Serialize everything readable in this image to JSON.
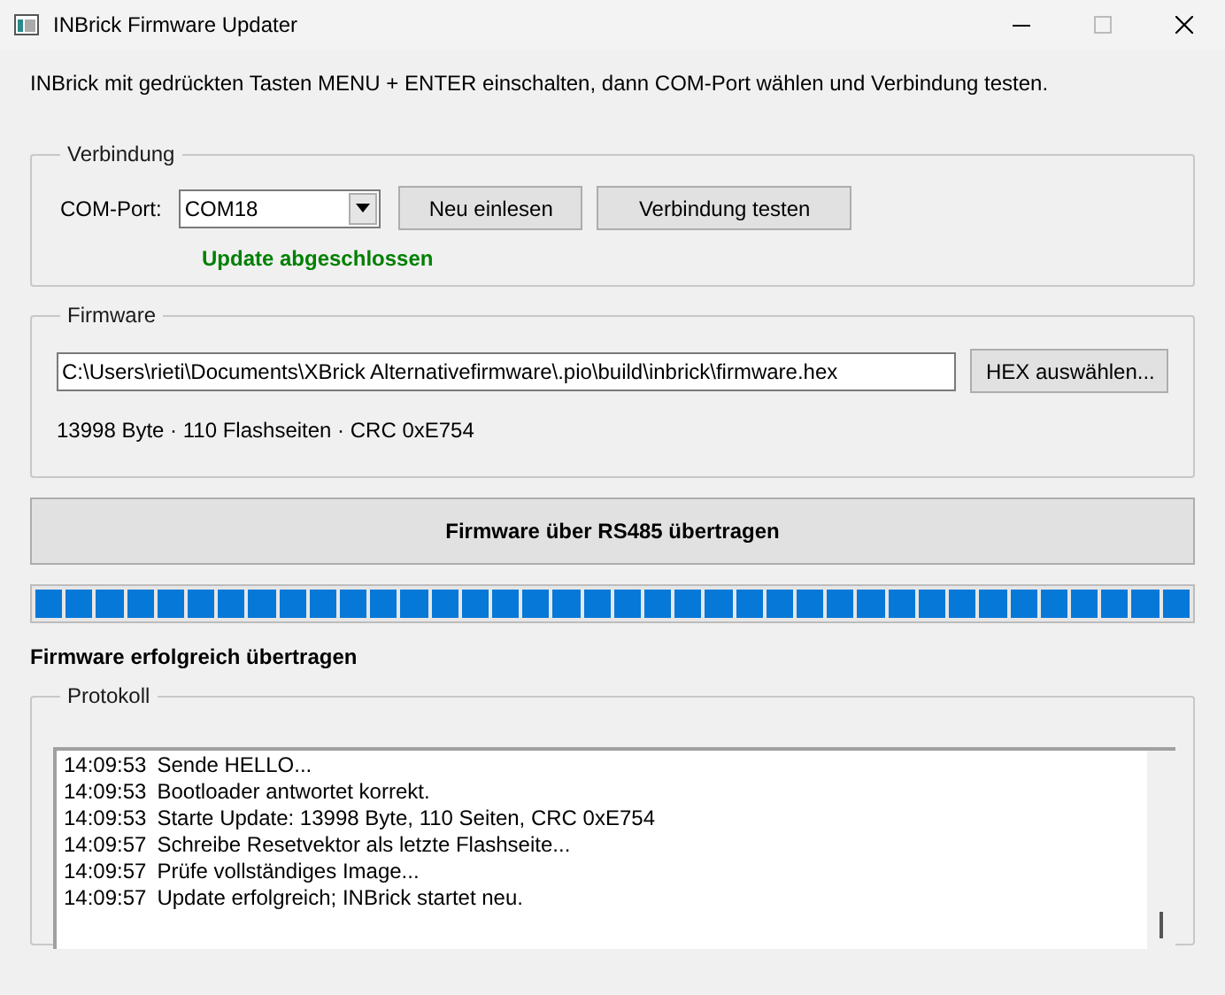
{
  "window": {
    "title": "INBrick Firmware Updater"
  },
  "instruction": "INBrick mit gedrückten Tasten MENU + ENTER einschalten, dann COM-Port wählen und Verbindung testen.",
  "connection": {
    "title": "Verbindung",
    "port_label": "COM-Port:",
    "port_value": "COM18",
    "rescan_button": "Neu einlesen",
    "test_button": "Verbindung testen",
    "status": "Update abgeschlossen"
  },
  "firmware": {
    "title": "Firmware",
    "path": "C:\\Users\\rieti\\Documents\\XBrick Alternativefirmware\\.pio\\build\\inbrick\\firmware.hex",
    "browse_button": "HEX auswählen...",
    "info": "13998 Byte · 110 Flashseiten · CRC 0xE754"
  },
  "transfer_button": "Firmware über RS485 übertragen",
  "progress": {
    "level": 1
  },
  "result": "Firmware erfolgreich übertragen",
  "log": {
    "title": "Protokoll",
    "lines": [
      {
        "time": "14:09:53",
        "message": "Sende HELLO..."
      },
      {
        "time": "14:09:53",
        "message": "Bootloader antwortet korrekt."
      },
      {
        "time": "14:09:53",
        "message": "Starte Update: 13998 Byte, 110 Seiten, CRC 0xE754"
      },
      {
        "time": "14:09:57",
        "message": "Schreibe Resetvektor als letzte Flashseite..."
      },
      {
        "time": "14:09:57",
        "message": "Prüfe vollständiges Image..."
      },
      {
        "time": "14:09:57",
        "message": "Update erfolgreich; INBrick startet neu."
      }
    ]
  }
}
